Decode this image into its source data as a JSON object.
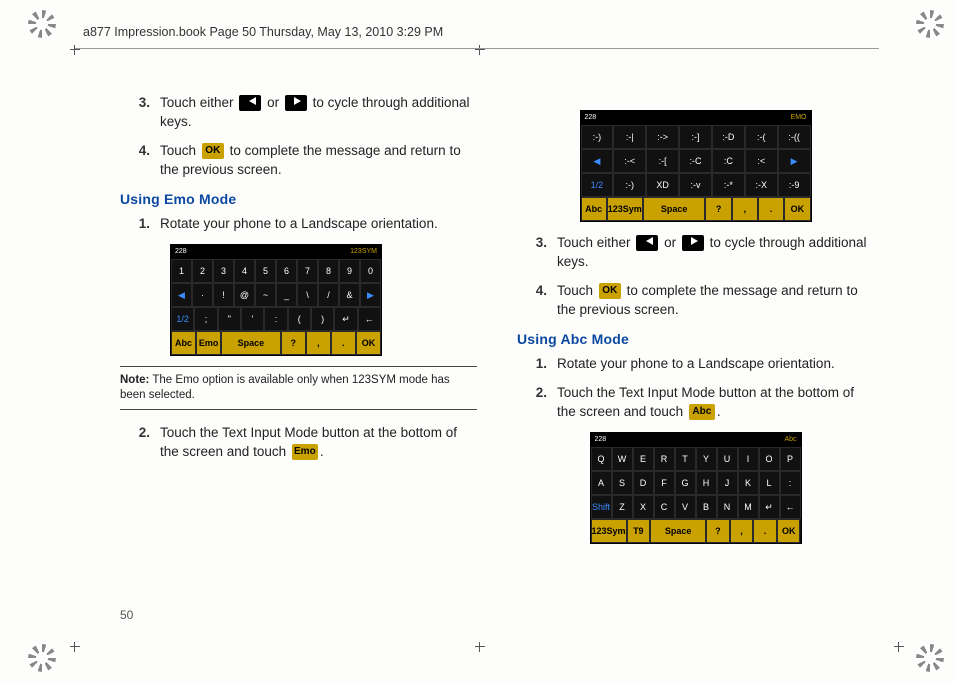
{
  "header": "a877 Impression.book  Page 50  Thursday, May 13, 2010  3:29 PM",
  "page_number": "50",
  "left": {
    "step3": "Touch either",
    "step3_mid": "or",
    "step3_end": "to cycle through additional keys.",
    "step4": "Touch",
    "step4_end": "to complete the message and return to the previous screen.",
    "section": "Using Emo Mode",
    "emo1": "Rotate your phone to a Landscape orientation.",
    "kb1": {
      "bar_left": "228",
      "bar_right": "123SYM",
      "rows": [
        [
          "1",
          "2",
          "3",
          "4",
          "5",
          "6",
          "7",
          "8",
          "9",
          "0"
        ],
        [
          "◀",
          "·",
          "!",
          "@",
          "~",
          "_",
          "\\",
          "/",
          "&",
          "▶"
        ],
        [
          "1/2",
          ";",
          "\"",
          "'",
          ":",
          "(",
          ")",
          "↵",
          "←"
        ],
        [
          "Abc",
          "Emo",
          "Space",
          "?",
          ",",
          ".",
          "OK"
        ]
      ]
    },
    "note_bold": "Note:",
    "note": "The Emo option is available only when 123SYM mode has been selected.",
    "emo2_a": "Touch the Text Input Mode button at the bottom of the screen and touch",
    "emo2_b": ".",
    "emo_btn": "Emo"
  },
  "right": {
    "kb2": {
      "bar_left": "228",
      "bar_right": "EMO",
      "rows": [
        [
          ":-)",
          ":-|",
          ":->",
          ":-]",
          ":-D",
          ":-(",
          ":-(("
        ],
        [
          "◀",
          ":-<",
          ":-[",
          ":-C",
          ":C",
          ":<",
          "▶"
        ],
        [
          "1/2",
          ":-)",
          "XD",
          ":-v",
          ":-*",
          ":-X",
          ":-9"
        ],
        [
          "Abc",
          "123Sym",
          "Space",
          "?",
          ",",
          ".",
          "OK"
        ]
      ]
    },
    "step3": "Touch either",
    "step3_mid": "or",
    "step3_end": "to cycle through additional keys.",
    "step4": "Touch",
    "step4_end": "to complete the message and return to the previous screen.",
    "section": "Using Abc Mode",
    "abc1": "Rotate your phone to a Landscape orientation.",
    "abc2_a": "Touch the Text Input Mode button at the bottom of the screen and touch",
    "abc2_b": ".",
    "abc_btn": "Abc",
    "kb3": {
      "bar_left": "228",
      "bar_right": "Abc",
      "rows": [
        [
          "Q",
          "W",
          "E",
          "R",
          "T",
          "Y",
          "U",
          "I",
          "O",
          "P"
        ],
        [
          "A",
          "S",
          "D",
          "F",
          "G",
          "H",
          "J",
          "K",
          "L",
          ":"
        ],
        [
          "Shift",
          "Z",
          "X",
          "C",
          "V",
          "B",
          "N",
          "M",
          "↵",
          "←"
        ],
        [
          "123Sym",
          "T9",
          "Space",
          "?",
          ",",
          ".",
          "OK"
        ]
      ]
    }
  },
  "ok_label": "OK"
}
